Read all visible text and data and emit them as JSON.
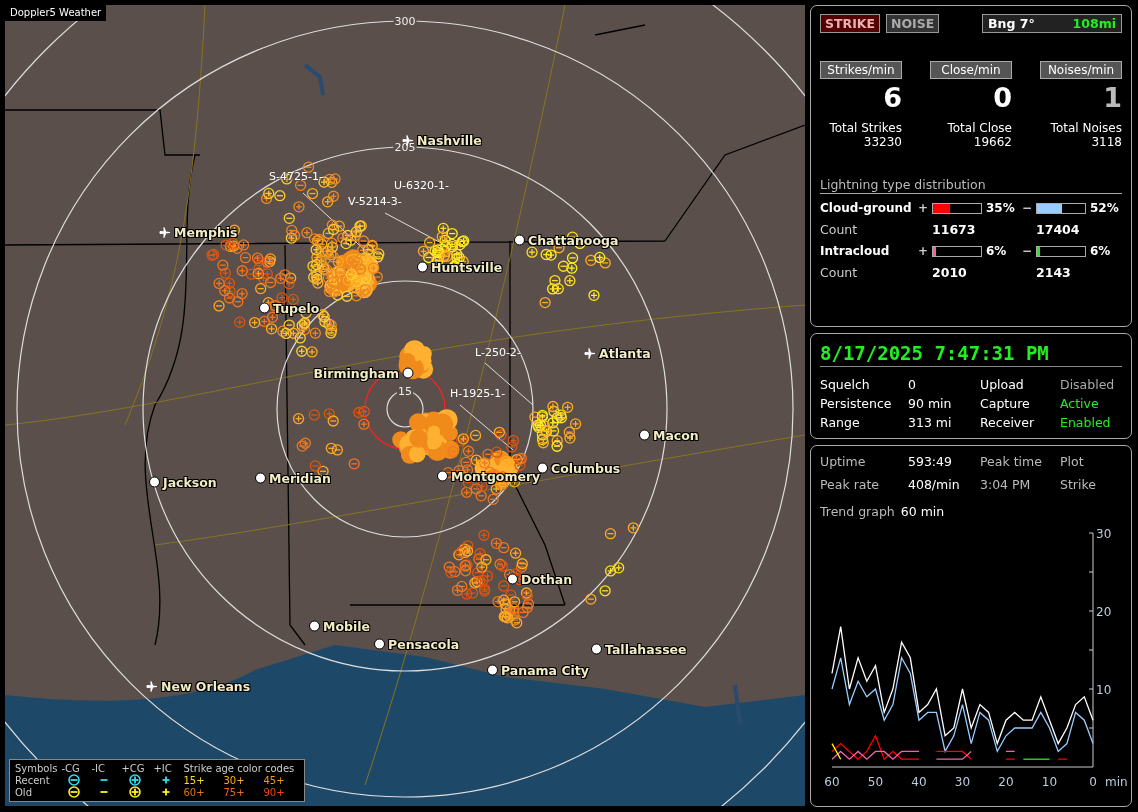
{
  "map": {
    "title": "Doppler5 Weather",
    "range_labels": [
      "300",
      "205",
      "15"
    ],
    "cities": [
      {
        "name": "Nashville",
        "kind": "airport"
      },
      {
        "name": "Memphis",
        "kind": "airport"
      },
      {
        "name": "Chattanooga",
        "kind": "city"
      },
      {
        "name": "Huntsville",
        "kind": "city"
      },
      {
        "name": "Tupelo",
        "kind": "city"
      },
      {
        "name": "Atlanta",
        "kind": "airport"
      },
      {
        "name": "Birmingham",
        "kind": "city_left"
      },
      {
        "name": "Macon",
        "kind": "city"
      },
      {
        "name": "Jackson",
        "kind": "city"
      },
      {
        "name": "Meridian",
        "kind": "city"
      },
      {
        "name": "Montgomery",
        "kind": "city"
      },
      {
        "name": "Columbus",
        "kind": "city"
      },
      {
        "name": "Dothan",
        "kind": "city"
      },
      {
        "name": "Mobile",
        "kind": "city"
      },
      {
        "name": "Pensacola",
        "kind": "city"
      },
      {
        "name": "Tallahassee",
        "kind": "city"
      },
      {
        "name": "Panama City",
        "kind": "city"
      },
      {
        "name": "New Orleans",
        "kind": "airport"
      }
    ],
    "storms": [
      "S-4725-1-",
      "U-6320-1-",
      "V-5214-3-",
      "L-250-2-",
      "H-1925-1-"
    ],
    "legend": {
      "title": "Symbols",
      "types": [
        {
          "label": "-CG",
          "kind": "circle_minus"
        },
        {
          "label": "-IC",
          "kind": "minus"
        },
        {
          "label": "+CG",
          "kind": "circle_plus"
        },
        {
          "label": "+IC",
          "kind": "plus"
        }
      ],
      "age_title": "Strike age color codes",
      "rows": [
        {
          "label": "Recent",
          "color": "#33ddee",
          "ages": [
            {
              "text": "15+",
              "color": "#ffdd22"
            },
            {
              "text": "30+",
              "color": "#ffaa22"
            },
            {
              "text": "45+",
              "color": "#ee9911"
            }
          ]
        },
        {
          "label": "Old",
          "color": "#ffee22",
          "ages": [
            {
              "text": "60+",
              "color": "#dd7711"
            },
            {
              "text": "75+",
              "color": "#ee6611"
            },
            {
              "text": "90+",
              "color": "#ee4411"
            }
          ]
        }
      ]
    }
  },
  "mode_buttons": [
    {
      "label": "STRIKE",
      "selected": true
    },
    {
      "label": "NOISE",
      "selected": false
    }
  ],
  "bearing": {
    "label": "Bng 7°",
    "distance": "108mi"
  },
  "rates": [
    {
      "label": "Strikes/min",
      "value": "6",
      "total_label": "Total Strikes",
      "total": "33230",
      "dim": false
    },
    {
      "label": "Close/min",
      "value": "0",
      "total_label": "Total Close",
      "total": "19662",
      "dim": false
    },
    {
      "label": "Noises/min",
      "value": "1",
      "total_label": "Total Noises",
      "total": "3118",
      "dim": true
    }
  ],
  "distribution": {
    "title": "Lightning type distribution",
    "types": [
      {
        "name": "Cloud-ground",
        "count_label": "Count",
        "plus": {
          "sign": "+",
          "level": 0.35,
          "pct": "35%",
          "color": "#ff0000",
          "count": "11673"
        },
        "minus": {
          "sign": "−",
          "level": 0.52,
          "pct": "52%",
          "color": "#99ccff",
          "count": "17404"
        }
      },
      {
        "name": "Intracloud",
        "count_label": "Count",
        "plus": {
          "sign": "+",
          "level": 0.06,
          "pct": "6%",
          "color": "#ee66aa",
          "count": "2010"
        },
        "minus": {
          "sign": "−",
          "level": 0.06,
          "pct": "6%",
          "color": "#22ee22",
          "count": "2143"
        }
      }
    ]
  },
  "status": {
    "datetime": "8/17/2025 7:47:31 PM",
    "rows": [
      {
        "label": "Squelch",
        "value": "0",
        "label2": "Upload",
        "value2": "Disabled",
        "on": false
      },
      {
        "label": "Persistence",
        "value": "90 min",
        "label2": "Capture",
        "value2": "Active",
        "on": true
      },
      {
        "label": "Range",
        "value": "313 mi",
        "label2": "Receiver",
        "value2": "Enabled",
        "on": true
      }
    ]
  },
  "stats": {
    "rows": [
      {
        "label": "Uptime",
        "value": "593:49",
        "label2": "Peak time",
        "value2": "Plot"
      },
      {
        "label": "Peak rate",
        "value": "408/min",
        "label2": "3:04 PM",
        "value2": "Strike"
      }
    ],
    "trend_label": "Trend graph",
    "trend_value": "60 min",
    "chart_data": {
      "type": "line",
      "xlabel": "min",
      "x": [
        -60,
        -58,
        -56,
        -54,
        -52,
        -50,
        -48,
        -46,
        -44,
        -42,
        -40,
        -38,
        -36,
        -34,
        -32,
        -30,
        -28,
        -26,
        -24,
        -22,
        -20,
        -18,
        -16,
        -14,
        -12,
        -10,
        -8,
        -6,
        -4,
        -2,
        0
      ],
      "xlim": [
        -60,
        0
      ],
      "ylim": [
        0,
        30
      ],
      "xticks": [
        {
          "value": -60,
          "label": "60"
        },
        {
          "value": -50,
          "label": "50"
        },
        {
          "value": -40,
          "label": "40"
        },
        {
          "value": -30,
          "label": "30"
        },
        {
          "value": -20,
          "label": "20"
        },
        {
          "value": -10,
          "label": "10"
        },
        {
          "value": 0,
          "label": "0"
        }
      ],
      "yticks": [
        10,
        20,
        30
      ],
      "series": [
        {
          "color": "#ffffff",
          "values": [
            12,
            18,
            10,
            14,
            11,
            13,
            7,
            10,
            16,
            14,
            7,
            8,
            10,
            4,
            5,
            10,
            5,
            8,
            7,
            3,
            6,
            7,
            6,
            6,
            9,
            6,
            3,
            5,
            8,
            9,
            6
          ]
        },
        {
          "color": "#99ccff",
          "values": [
            10,
            14,
            8,
            11,
            9,
            10,
            6,
            8,
            14,
            12,
            6,
            7,
            7,
            2,
            4,
            8,
            3,
            7,
            6,
            2,
            4,
            5,
            5,
            5,
            7,
            5,
            2,
            3,
            7,
            6,
            3
          ]
        },
        {
          "color": "#ff0000",
          "values": [
            2,
            3,
            2,
            1,
            2,
            4,
            1,
            2,
            1,
            1,
            1,
            null,
            2,
            2,
            2,
            2,
            1,
            null,
            null,
            null,
            1,
            1,
            null,
            null,
            null,
            null,
            1,
            1,
            null,
            null,
            null
          ]
        },
        {
          "color": "#ee66aa",
          "values": [
            1,
            2,
            1,
            2,
            1,
            2,
            2,
            1,
            2,
            2,
            2,
            null,
            1,
            1,
            1,
            1,
            2,
            null,
            null,
            null,
            2,
            2,
            null,
            null,
            null,
            null,
            null,
            null,
            null,
            null,
            null
          ]
        },
        {
          "color": "#22ee22",
          "values": [
            null,
            null,
            null,
            null,
            null,
            null,
            null,
            null,
            null,
            null,
            null,
            null,
            null,
            null,
            null,
            null,
            null,
            null,
            null,
            null,
            null,
            null,
            1,
            1,
            1,
            1,
            null,
            null,
            null,
            null,
            null
          ]
        },
        {
          "color": "#ffff00",
          "values": [
            3,
            1,
            null,
            null,
            null,
            null,
            null,
            null,
            null,
            null,
            null,
            null,
            null,
            null,
            null,
            null,
            null,
            null,
            null,
            null,
            null,
            null,
            null,
            null,
            null,
            null,
            null,
            null,
            null,
            null,
            null
          ]
        }
      ]
    }
  }
}
